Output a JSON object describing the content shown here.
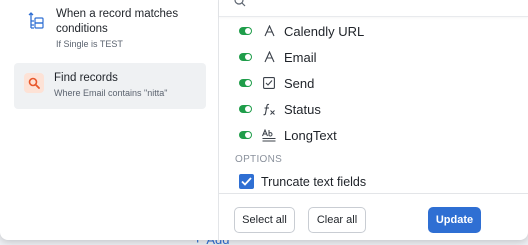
{
  "background": {
    "add_label": "Add"
  },
  "left_panel": {
    "trigger": {
      "title": "When a record matches conditions",
      "subtitle": "If Single is TEST",
      "icon": "list-tree-icon"
    },
    "action": {
      "title": "Find records",
      "subtitle": "Where Email contains \"nitta\"",
      "icon": "search-icon"
    }
  },
  "right_panel": {
    "fields": [
      {
        "label": "Calendly URL",
        "icon": "text-field-icon",
        "enabled": true
      },
      {
        "label": "Email",
        "icon": "text-field-icon",
        "enabled": true
      },
      {
        "label": "Send",
        "icon": "checkbox-field-icon",
        "enabled": true
      },
      {
        "label": "Status",
        "icon": "formula-field-icon",
        "enabled": true
      },
      {
        "label": "LongText",
        "icon": "long-text-field-icon",
        "enabled": true
      }
    ],
    "options_label": "OPTIONS",
    "truncate_label": "Truncate text fields",
    "truncate_checked": true,
    "buttons": {
      "select_all": "Select all",
      "clear_all": "Clear all",
      "update": "Update"
    }
  },
  "colors": {
    "accent_blue": "#2f6fd3",
    "toggle_green": "#1f9d4a",
    "action_icon_bg": "#fde2d6",
    "action_icon_fg": "#e8572b"
  }
}
